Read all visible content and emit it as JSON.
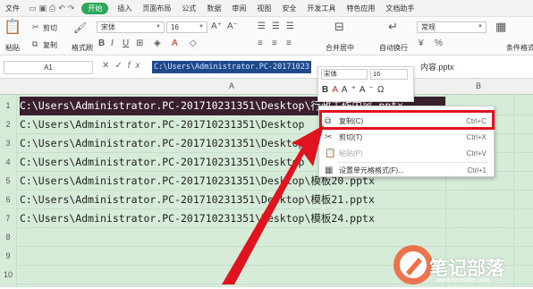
{
  "menubar": {
    "file": "文件",
    "start": "开始",
    "tabs": [
      "插入",
      "页面布局",
      "公式",
      "数据",
      "审阅",
      "视图",
      "安全",
      "开发工具",
      "特色应用",
      "文档助手"
    ]
  },
  "toolbar": {
    "cut": "剪切",
    "copy": "复制",
    "paste": "粘贴",
    "format_painter": "格式刷",
    "font_name": "宋体",
    "font_size": "16",
    "merge_center": "合并居中",
    "wrap": "自动换行",
    "number_format": "常规",
    "cond_format": "条件格式"
  },
  "formula_bar": {
    "name_box": "A1",
    "content_selected": "C:\\Users\\Administrator.PC-20171023",
    "content_rest": "内容.pptx"
  },
  "columns": [
    "A",
    "B"
  ],
  "rows": [
    {
      "num": "1",
      "text": "C:\\Users\\Administrator.PC-201710231351\\Desktop\\行政工作内容.pptx"
    },
    {
      "num": "2",
      "text": "C:\\Users\\Administrator.PC-201710231351\\Desktop"
    },
    {
      "num": "3",
      "text": "C:\\Users\\Administrator.PC-201710231351\\Desktop"
    },
    {
      "num": "4",
      "text": "C:\\Users\\Administrator.PC-201710231351\\Desktop"
    },
    {
      "num": "5",
      "text": "C:\\Users\\Administrator.PC-201710231351\\Desktop\\模板20.pptx"
    },
    {
      "num": "6",
      "text": "C:\\Users\\Administrator.PC-201710231351\\Desktop\\模板21.pptx"
    },
    {
      "num": "7",
      "text": "C:\\Users\\Administrator.PC-201710231351\\Desktop\\模板24.pptx"
    },
    {
      "num": "8",
      "text": ""
    },
    {
      "num": "9",
      "text": ""
    },
    {
      "num": "10",
      "text": ""
    }
  ],
  "mini_toolbar": {
    "font": "宋体",
    "size": "16"
  },
  "context_menu": [
    {
      "label": "复制(C)",
      "shortcut": "Ctrl+C",
      "icon": "copy-icon",
      "enabled": true
    },
    {
      "label": "剪切(T)",
      "shortcut": "Ctrl+X",
      "icon": "cut-icon",
      "enabled": true
    },
    {
      "label": "粘贴(P)",
      "shortcut": "Ctrl+V",
      "icon": "paste-icon",
      "enabled": false
    },
    {
      "label": "设置单元格格式(F)...",
      "shortcut": "Ctrl+1",
      "icon": "format-cells-icon",
      "enabled": true
    }
  ],
  "watermark": {
    "title": "笔记部落",
    "url": "www.notetribe.com"
  },
  "colors": {
    "accent": "#2ba85a",
    "highlight": "#e0141e",
    "grid_bg": "#d6ecd9"
  }
}
